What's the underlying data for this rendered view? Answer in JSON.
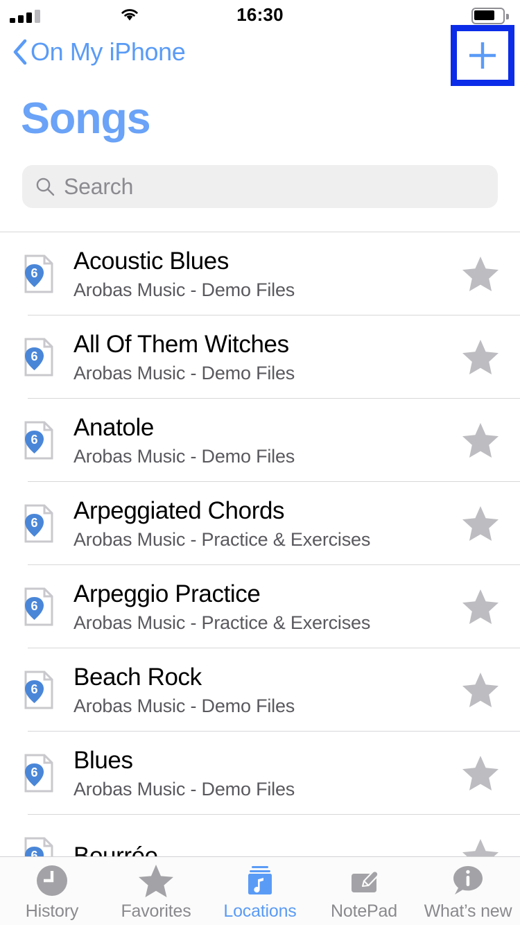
{
  "statusbar": {
    "time": "16:30",
    "signal_icon": "cellular-signal-icon",
    "wifi_icon": "wifi-icon",
    "battery_icon": "battery-icon",
    "battery_level_pct": 70,
    "signal_bars_filled": 3,
    "signal_bars_total": 4
  },
  "navbar": {
    "back_label": "On My iPhone",
    "back_icon": "chevron-left-icon",
    "add_label": "+",
    "add_icon": "plus-icon",
    "highlight_color": "#0b2ce8",
    "tint_color": "#5a9bf6"
  },
  "header": {
    "title": "Songs"
  },
  "search": {
    "placeholder": "Search",
    "value": "",
    "icon": "search-icon"
  },
  "list": {
    "file_icon": "guitar-pro-file-icon",
    "file_icon_badge": "6",
    "star_icon": "star-icon",
    "rows": [
      {
        "title": "Acoustic Blues",
        "subtitle": "Arobas Music - Demo Files"
      },
      {
        "title": "All Of Them Witches",
        "subtitle": "Arobas Music - Demo Files"
      },
      {
        "title": "Anatole",
        "subtitle": "Arobas Music - Demo Files"
      },
      {
        "title": "Arpeggiated Chords",
        "subtitle": "Arobas Music - Practice & Exercises"
      },
      {
        "title": "Arpeggio Practice",
        "subtitle": "Arobas Music - Practice & Exercises"
      },
      {
        "title": "Beach Rock",
        "subtitle": "Arobas Music - Demo Files"
      },
      {
        "title": "Blues",
        "subtitle": "Arobas Music - Demo Files"
      },
      {
        "title": "Bourrée",
        "subtitle": ""
      }
    ]
  },
  "tabbar": {
    "active_index": 2,
    "items": [
      {
        "label": "History",
        "icon": "clock-icon"
      },
      {
        "label": "Favorites",
        "icon": "star-icon"
      },
      {
        "label": "Locations",
        "icon": "music-folder-icon"
      },
      {
        "label": "NotePad",
        "icon": "pencil-note-icon"
      },
      {
        "label": "What’s new",
        "icon": "info-bubble-icon"
      }
    ]
  }
}
